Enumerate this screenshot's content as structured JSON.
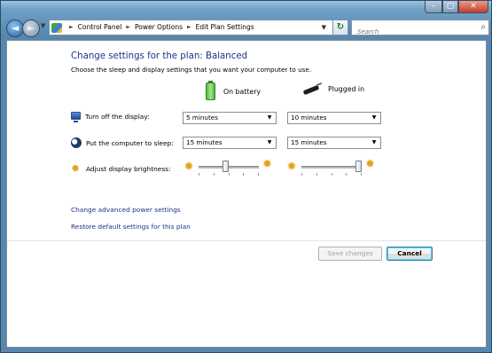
{
  "window": {
    "controls": {
      "minimize": "–",
      "maximize": "▢",
      "close": "✕"
    }
  },
  "nav": {
    "back_icon": "◄",
    "forward_icon": "►",
    "recent_icon": "▼",
    "breadcrumb": [
      "Control Panel",
      "Power Options",
      "Edit Plan Settings"
    ],
    "address_dropdown": "▼",
    "refresh_icon": "↻",
    "search_placeholder": "Search",
    "search_icon": "⌕"
  },
  "page": {
    "title": "Change settings for the plan: Balanced",
    "subtitle": "Choose the sleep and display settings that you want your computer to use."
  },
  "columns": {
    "battery": "On battery",
    "plugged": "Plugged in"
  },
  "settings": {
    "display": {
      "label": "Turn off the display:",
      "battery": "5 minutes",
      "plugged": "10 minutes"
    },
    "sleep": {
      "label": "Put the computer to sleep:",
      "battery": "15 minutes",
      "plugged": "15 minutes"
    },
    "brightness": {
      "label": "Adjust display brightness:",
      "battery_level": 0.45,
      "plugged_level": 1.0
    }
  },
  "select_arrow": "▼",
  "links": {
    "advanced": "Change advanced power settings",
    "restore": "Restore default settings for this plan"
  },
  "buttons": {
    "save": "Save changes",
    "cancel": "Cancel"
  },
  "colors": {
    "link": "#1e3287",
    "title": "#1e3287",
    "frame": "#5887ad"
  }
}
